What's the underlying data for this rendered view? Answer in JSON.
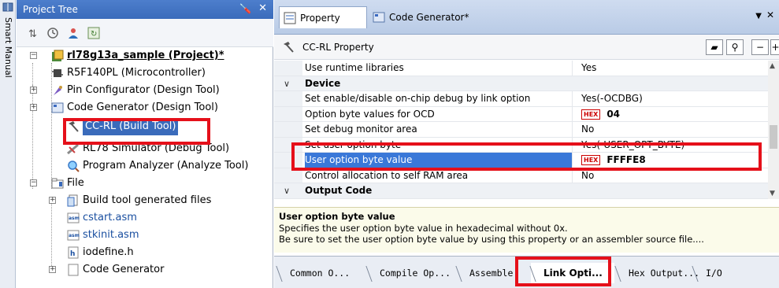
{
  "smart_manual": {
    "label": "Smart Manual"
  },
  "project_tree": {
    "title": "Project Tree",
    "nodes": [
      {
        "label": "rl78g13a_sample (Project)*"
      },
      {
        "label": "R5F140PL (Microcontroller)"
      },
      {
        "label": "Pin Configurator (Design Tool)"
      },
      {
        "label": "Code Generator (Design Tool)"
      },
      {
        "label": "CC-RL (Build Tool)"
      },
      {
        "label": "RL78 Simulator (Debug Tool)"
      },
      {
        "label": "Program Analyzer (Analyze Tool)"
      },
      {
        "label": "File"
      },
      {
        "label": "Build tool generated files"
      },
      {
        "label": "cstart.asm"
      },
      {
        "label": "stkinit.asm"
      },
      {
        "label": "iodefine.h"
      },
      {
        "label": "Code Generator"
      }
    ]
  },
  "property_panel": {
    "tabs": [
      {
        "label": "Property"
      },
      {
        "label": "Code Generator*"
      }
    ],
    "header_title": "CC-RL Property",
    "header_buttons": {
      "minus": "−",
      "plus": "+"
    },
    "rows": [
      {
        "name": "Use runtime libraries",
        "value": "Yes"
      },
      {
        "name": "Device",
        "value": ""
      },
      {
        "name": "Set enable/disable on-chip debug by link option",
        "value": "Yes(-OCDBG)"
      },
      {
        "name": "Option byte values for OCD",
        "value": "04"
      },
      {
        "name": "Set debug monitor area",
        "value": "No"
      },
      {
        "name": "Set user option byte",
        "value": "Yes(-USER_OPT_BYTE)"
      },
      {
        "name": "User option byte value",
        "value": "FFFFE8"
      },
      {
        "name": "Control allocation to self RAM area",
        "value": "No"
      },
      {
        "name": "Output Code",
        "value": ""
      }
    ],
    "hex_badge": "HEX",
    "description": {
      "title": "User option byte value",
      "line1": "Specifies the user option byte value in hexadecimal without 0x.",
      "line2": "Be sure to set the user option byte value by using this property or an assembler source file...."
    },
    "bottom_tabs": [
      {
        "label": "Common O..."
      },
      {
        "label": "Compile Op..."
      },
      {
        "label": "Assemble O..."
      },
      {
        "label": "Link Opti..."
      },
      {
        "label": "Hex Output..."
      },
      {
        "label": "I/O Header..."
      }
    ]
  },
  "colors": {
    "highlight_box": "#e5101a",
    "selected_row": "#3a78d8",
    "title_bar": "#3a6bbb"
  }
}
